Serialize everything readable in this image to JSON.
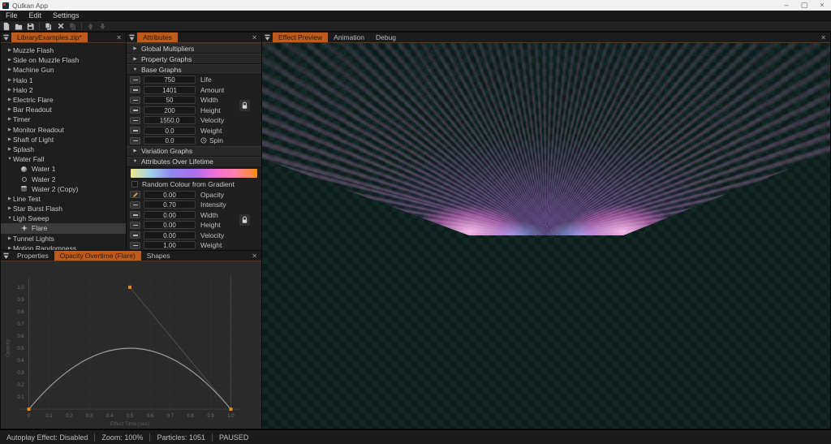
{
  "window": {
    "title": "Qulkan App",
    "controls": [
      {
        "name": "minimize",
        "glyph": "–"
      },
      {
        "name": "maximize",
        "glyph": "▢"
      },
      {
        "name": "close",
        "glyph": "×"
      }
    ]
  },
  "menubar": {
    "items": [
      "File",
      "Edit",
      "Settings"
    ]
  },
  "toolbar": {
    "buttons": [
      {
        "name": "new-file",
        "enabled": true
      },
      {
        "name": "open-file",
        "enabled": true
      },
      {
        "name": "save",
        "enabled": true
      },
      {
        "sep": true
      },
      {
        "name": "duplicate",
        "enabled": true
      },
      {
        "name": "delete",
        "enabled": true
      },
      {
        "name": "copy",
        "enabled": false
      },
      {
        "sep": true
      },
      {
        "name": "move-up",
        "enabled": false
      },
      {
        "name": "move-down",
        "enabled": false
      }
    ]
  },
  "library_panel": {
    "tabs": [
      {
        "label": "LibraryExamples.zip*"
      }
    ],
    "active_tab": 0,
    "items": [
      {
        "label": "Muzzle Flash",
        "kind": "group",
        "state": "collapsed"
      },
      {
        "label": "Side on Muzzle Flash",
        "kind": "group",
        "state": "collapsed"
      },
      {
        "label": "Machine Gun",
        "kind": "group",
        "state": "collapsed"
      },
      {
        "label": "Halo 1",
        "kind": "group",
        "state": "collapsed"
      },
      {
        "label": "Halo 2",
        "kind": "group",
        "state": "collapsed"
      },
      {
        "label": "Electric Flare",
        "kind": "group",
        "state": "collapsed"
      },
      {
        "label": "Bar Readout",
        "kind": "group",
        "state": "collapsed"
      },
      {
        "label": "Timer",
        "kind": "group",
        "state": "collapsed"
      },
      {
        "label": "Monitor Readout",
        "kind": "group",
        "state": "collapsed"
      },
      {
        "label": "Shaft of Light",
        "kind": "group",
        "state": "collapsed"
      },
      {
        "label": "Splash",
        "kind": "group",
        "state": "collapsed"
      },
      {
        "label": "Water Fall",
        "kind": "group",
        "state": "expanded"
      },
      {
        "label": "Water 1",
        "kind": "child",
        "icon": "sphere-solid"
      },
      {
        "label": "Water 2",
        "kind": "child",
        "icon": "sphere-outline"
      },
      {
        "label": "Water 2 (Copy)",
        "kind": "child",
        "icon": "sphere-dark"
      },
      {
        "label": "Line Test",
        "kind": "group",
        "state": "collapsed"
      },
      {
        "label": "Star Burst Flash",
        "kind": "group",
        "state": "collapsed"
      },
      {
        "label": "Ligh Sweep",
        "kind": "group",
        "state": "expanded"
      },
      {
        "label": "Flare",
        "kind": "child",
        "icon": "flare-star",
        "selected": true
      },
      {
        "label": "Tunnel Lights",
        "kind": "group",
        "state": "collapsed"
      },
      {
        "label": "Motion Randomness",
        "kind": "group",
        "state": "collapsed"
      }
    ]
  },
  "attributes_panel": {
    "tabs": [
      {
        "label": "Attributes"
      }
    ],
    "active_tab": 0,
    "sections": [
      {
        "label": "Global Multipliers",
        "collapsed": true
      },
      {
        "label": "Property Graphs",
        "collapsed": true
      },
      {
        "label": "Base Graphs",
        "collapsed": false,
        "rows": [
          {
            "value": "750",
            "label": "Life"
          },
          {
            "value": "1401",
            "label": "Amount"
          },
          {
            "value": "50",
            "label": "Width",
            "lock": true
          },
          {
            "value": "200",
            "label": "Height"
          },
          {
            "value": "1550.0",
            "label": "Velocity"
          },
          {
            "value": "0.0",
            "label": "Weight"
          },
          {
            "value": "0.0",
            "label": "Spin",
            "clock": true
          }
        ]
      },
      {
        "label": "Variation Graphs",
        "collapsed": true
      },
      {
        "label": "Attributes Over Lifetime",
        "collapsed": false,
        "gradient": true,
        "checkbox": "Random Colour from Gradient",
        "checked": false,
        "rows": [
          {
            "value": "0.00",
            "label": "Opacity",
            "pencil": true
          },
          {
            "value": "0.70",
            "label": "Intensity"
          },
          {
            "value": "0.00",
            "label": "Width",
            "lock": true
          },
          {
            "value": "0.00",
            "label": "Height"
          },
          {
            "value": "0.00",
            "label": "Velocity"
          },
          {
            "value": "1.00",
            "label": "Weight"
          }
        ]
      }
    ],
    "gradient_stops": [
      {
        "color": "#efe88a",
        "pos": 0
      },
      {
        "color": "#9fd4e6",
        "pos": 15
      },
      {
        "color": "#8f86ee",
        "pos": 32
      },
      {
        "color": "#a96ef2",
        "pos": 50
      },
      {
        "color": "#ef6fd8",
        "pos": 66
      },
      {
        "color": "#ff7fae",
        "pos": 82
      },
      {
        "color": "#f68b1f",
        "pos": 100
      }
    ]
  },
  "preview_panel": {
    "tabs": [
      {
        "label": "Effect Preview"
      },
      {
        "label": "Animation"
      },
      {
        "label": "Debug"
      }
    ],
    "active_tab": 0
  },
  "bottom_panel": {
    "tabs": [
      {
        "label": "Properties"
      },
      {
        "label": "Opacity Overtime (Flare)"
      },
      {
        "label": "Shapes"
      }
    ],
    "active_tab": 1,
    "graph": {
      "type": "line",
      "ylabel": "Opacity",
      "xlabel": "Effect Time (sec)",
      "xticks": [
        "0",
        "0.1",
        "0.2",
        "0.3",
        "0.4",
        "0.5",
        "0.6",
        "0.7",
        "0.8",
        "0.9",
        "1.0"
      ],
      "yticks": [
        "0.1",
        "0.2",
        "0.3",
        "0.4",
        "0.5",
        "0.6",
        "0.7",
        "0.8",
        "0.9",
        "1.0"
      ],
      "xlim": [
        0,
        1.0
      ],
      "ylim": [
        0,
        1.0
      ],
      "control_points": [
        {
          "x": 0,
          "y": 0
        },
        {
          "x": 0.5,
          "y": 1.0
        },
        {
          "x": 1.0,
          "y": 0
        }
      ],
      "curve_peak": 0.5
    }
  },
  "statusbar": {
    "items": [
      "Autoplay Effect: Disabled",
      "Zoom: 100%",
      "Particles: 1051",
      "PAUSED"
    ]
  },
  "colors": {
    "accent_orange": "#bd5a1c",
    "point_orange": "#e5891d",
    "checker_dark": "#0d1d1c",
    "checker_light": "#122825",
    "curve": "#9c9c9c"
  }
}
